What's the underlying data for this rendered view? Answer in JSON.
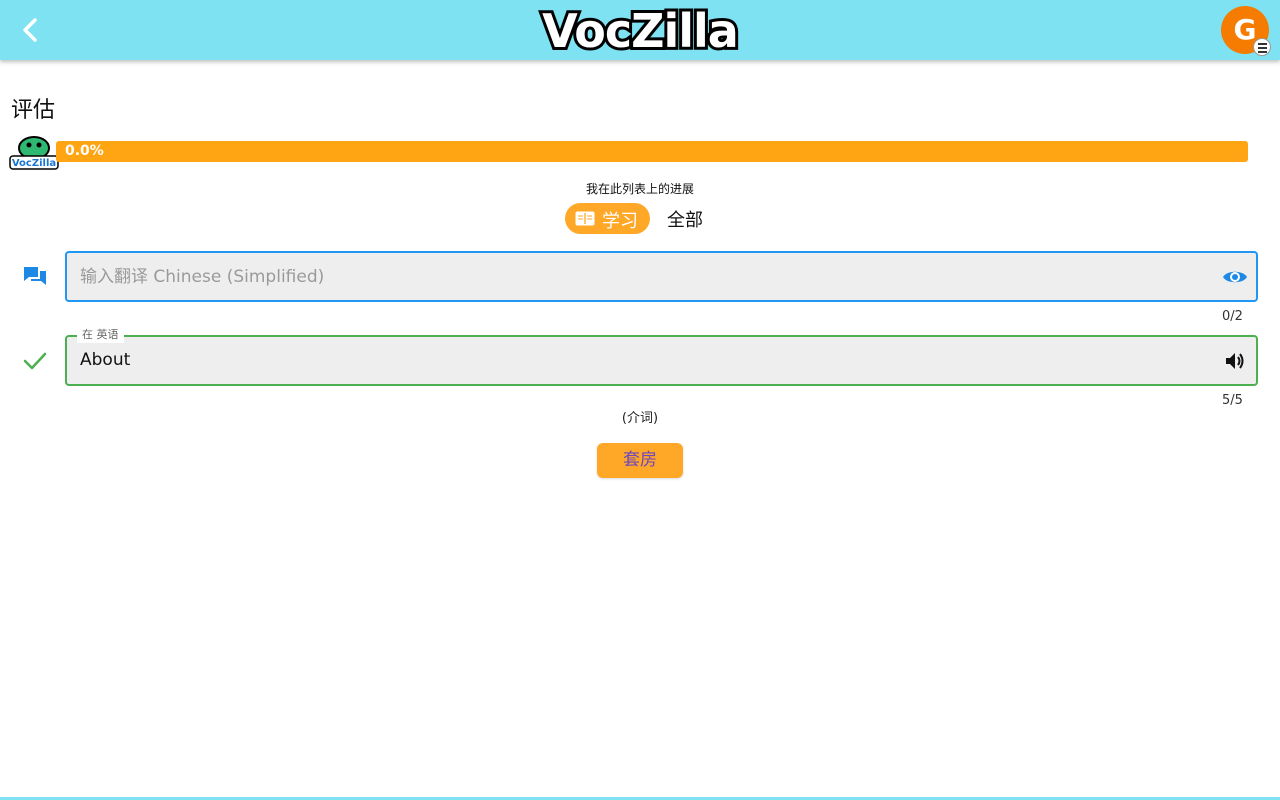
{
  "header": {
    "logo_text": "VocZilla",
    "avatar_initial": "G"
  },
  "page": {
    "title": "评估"
  },
  "progress": {
    "value_percent": 0.0,
    "label": "0.0%",
    "caption": "我在此列表上的进展"
  },
  "mode_toggle": {
    "study_label": "学习",
    "all_label": "全部",
    "selected": "study"
  },
  "translation_field": {
    "placeholder": "输入翻译 Chinese (Simplified)",
    "value": "",
    "counter": "0/2"
  },
  "english_field": {
    "legend": "在 英语",
    "value": "About",
    "counter": "5/5"
  },
  "part_of_speech": "(介词)",
  "submit": {
    "label": "套房"
  },
  "colors": {
    "header": "#7fe2f2",
    "accent_orange": "#ffa726",
    "progress_orange": "#ff8f00",
    "input_active_blue": "#2196f3",
    "correct_green": "#4caf50",
    "button_text_purple": "#6b46c1",
    "avatar": "#f57c00"
  }
}
